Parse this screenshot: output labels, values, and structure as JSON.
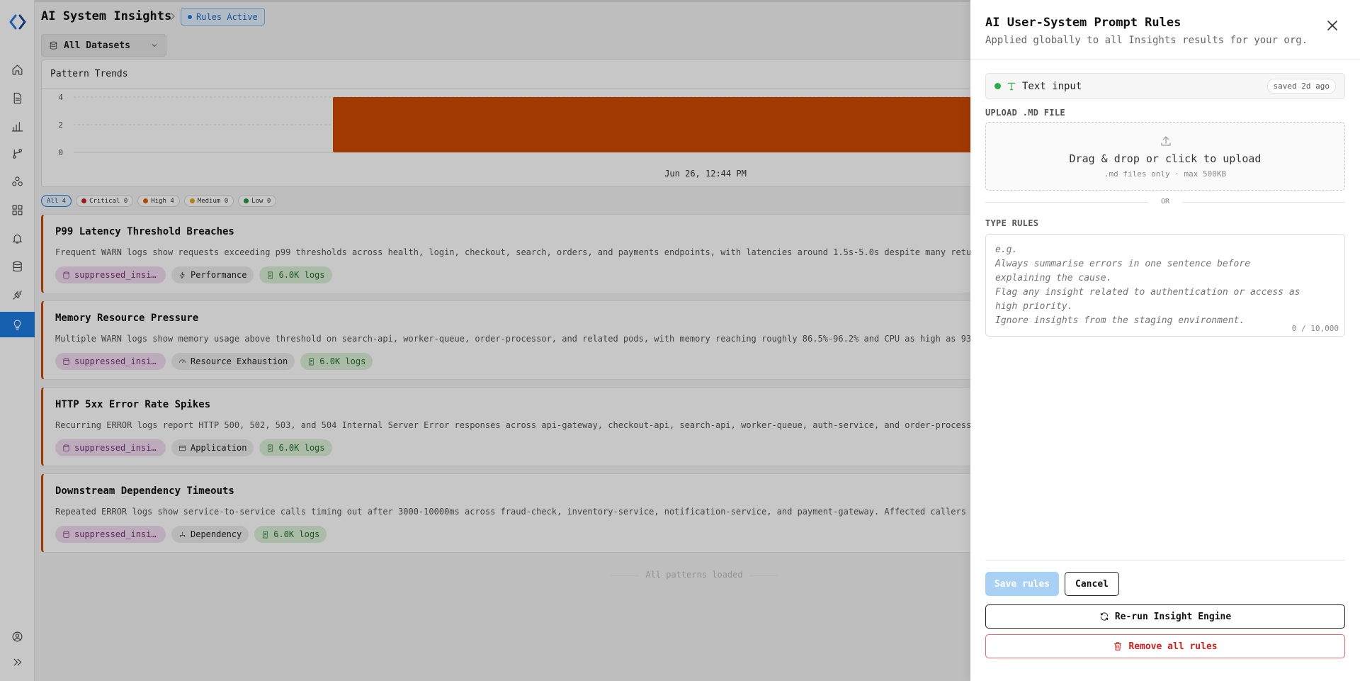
{
  "app": {
    "title": "AI System Insights",
    "rules_badge": "Rules Active"
  },
  "colors": {
    "accent": "#1e7ae0",
    "bar": "#d04b00",
    "critical": "#cc1f1f",
    "high": "#e05c00",
    "medium": "#e7a613",
    "low": "#1f9a35"
  },
  "sidebar": {
    "items": [
      {
        "icon": "home-icon"
      },
      {
        "icon": "document-icon"
      },
      {
        "icon": "bar-chart-icon"
      },
      {
        "icon": "git-branch-icon"
      },
      {
        "icon": "cluster-icon"
      },
      {
        "icon": "grid-icon"
      },
      {
        "icon": "bell-icon"
      },
      {
        "icon": "database-icon"
      },
      {
        "icon": "plug-icon"
      },
      {
        "icon": "lightbulb-icon",
        "active": true
      }
    ],
    "bottom": [
      {
        "icon": "user-circle-icon"
      },
      {
        "icon": "expand-icon"
      }
    ]
  },
  "toolbar": {
    "dataset_label": "All Datasets"
  },
  "trend": {
    "title": "Pattern Trends"
  },
  "chart_data": {
    "type": "bar",
    "title": "Pattern Trends",
    "categories": [
      "Jun 26, 12:44 PM"
    ],
    "values": [
      4
    ],
    "ylim": [
      0,
      4
    ],
    "yticks": [
      0,
      2,
      4
    ],
    "grid": true,
    "legend": "none"
  },
  "filters": [
    {
      "label": "All 4",
      "active": true,
      "color": ""
    },
    {
      "label": "Critical 0",
      "color": "#cc1f1f"
    },
    {
      "label": "High 4",
      "color": "#e05c00"
    },
    {
      "label": "Medium 0",
      "color": "#e7a613"
    },
    {
      "label": "Low 0",
      "color": "#1f9a35"
    }
  ],
  "cards": [
    {
      "title": "P99 Latency Threshold Breaches",
      "desc": "Frequent WARN logs show requests exceeding p99 thresholds across health, login, checkout, search, orders, and payments endpoints, with latencies around 1.5s-5.0s despite many returning",
      "dataset": "suppressed_insights",
      "category": "Performance",
      "category_icon": "bolt-icon",
      "logs": "6.0K logs"
    },
    {
      "title": "Memory Resource Pressure",
      "desc": "Multiple WARN logs show memory usage above threshold on search-api, worker-queue, order-processor, and related pods, with memory reaching roughly 86.5%-96.2% and CPU as high as 93",
      "dataset": "suppressed_insights",
      "category": "Resource Exhaustion",
      "category_icon": "gauge-icon",
      "logs": "6.0K logs"
    },
    {
      "title": "HTTP 5xx Error Rate Spikes",
      "desc": "Recurring ERROR logs report HTTP 500, 502, 503, and 504 Internal Server Error responses across api-gateway, checkout-api, search-api, worker-queue, auth-service, and order-processor",
      "dataset": "suppressed_insights",
      "category": "Application",
      "category_icon": "window-icon",
      "logs": "6.0K logs"
    },
    {
      "title": "Downstream Dependency Timeouts",
      "desc": "Repeated ERROR logs show service-to-service calls timing out after 3000-10000ms across fraud-check, inventory-service, notification-service, and payment-gateway. Affected callers",
      "dataset": "suppressed_insights",
      "category": "Dependency",
      "category_icon": "hierarchy-icon",
      "logs": "6.0K logs"
    }
  ],
  "footer_status": "All patterns loaded",
  "panel": {
    "title": "AI User-System Prompt Rules",
    "subtitle": "Applied globally to all Insights results for your org.",
    "source_label": "Text input",
    "saved_label": "saved 2d ago",
    "upload_label": "UPLOAD .MD FILE",
    "drop_main": "Drag & drop or click to upload",
    "drop_sub": ".md files only · max 500KB",
    "or_label": "OR",
    "type_label": "TYPE RULES",
    "placeholder": "e.g.\nAlways summarise errors in one sentence before\nexplaining the cause.\nFlag any insight related to authentication or access as\nhigh priority.\nIgnore insights from the staging environment.",
    "char_count": "0 / 10,000",
    "save_label": "Save rules",
    "cancel_label": "Cancel",
    "rerun_label": "Re-run Insight Engine",
    "remove_label": "Remove all rules"
  }
}
